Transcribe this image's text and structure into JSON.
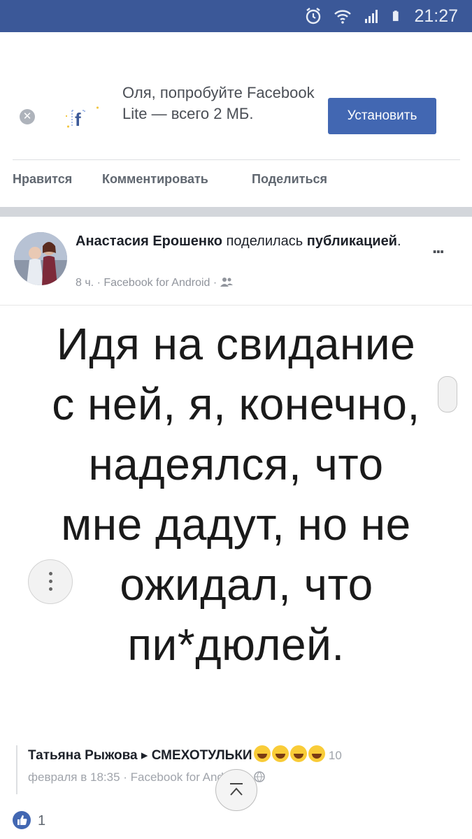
{
  "status_bar": {
    "time": "21:27",
    "icons": [
      "alarm-icon",
      "wifi-icon",
      "signal-icon",
      "battery-icon"
    ],
    "bg_color": "#3b5898"
  },
  "promo": {
    "text": "Оля, попробуйте Facebook Lite — всего 2 МБ.",
    "install_label": "Установить",
    "accent": "#4267b2"
  },
  "actions": {
    "like": "Нравится",
    "comment": "Комментировать",
    "share": "Поделиться"
  },
  "post": {
    "author": "Анастасия Ерошенко",
    "action_text": "поделилась",
    "action_object": "публикацией",
    "meta": "8 ч. · Facebook for Android ·",
    "more": "...",
    "meme_lines": [
      "Идя на свидание",
      "с ней, я, конечно,",
      "надеялся, что",
      "мне дадут, но не",
      "ожидал, что",
      "пи*дюлей."
    ]
  },
  "comment": {
    "author": "Татьяна Рыжова",
    "arrow": "▸",
    "group": "СМЕХОТУЛЬКИ",
    "date_part1": "10",
    "date_part2": "февраля в 18:35 · Facebook for Android ·",
    "likes": "1"
  }
}
